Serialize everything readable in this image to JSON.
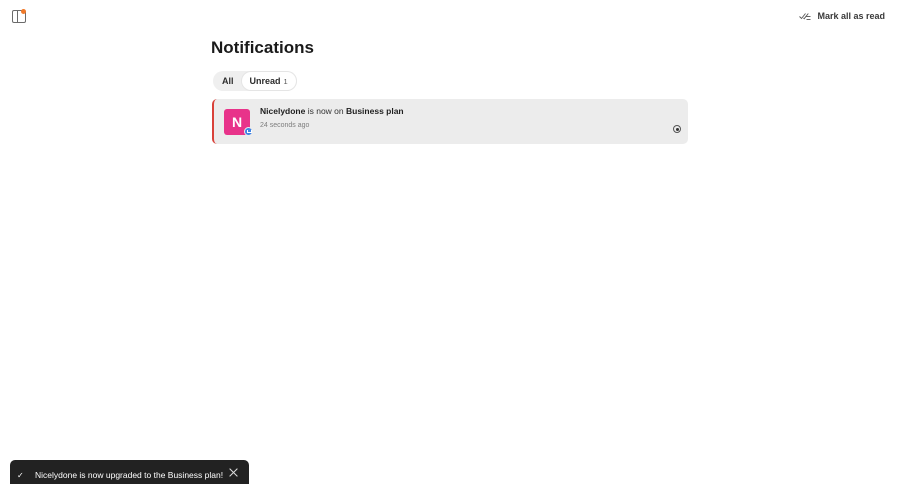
{
  "header": {
    "mark_all_label": "Mark all as read"
  },
  "page": {
    "title": "Notifications"
  },
  "tabs": [
    {
      "label": "All"
    },
    {
      "label": "Unread",
      "count": "1"
    }
  ],
  "notification": {
    "avatar_letter": "N",
    "actor": "Nicelydone",
    "text_mid": " is now on ",
    "plan": "Business plan",
    "time": "24 seconds ago"
  },
  "toast": {
    "message": "Nicelydone is now upgraded to the Business plan!"
  },
  "colors": {
    "avatar": "#e8338a",
    "unread_marker": "#d9423a",
    "toggle_dot": "#f07a2a",
    "badge": "#3f84e5"
  }
}
